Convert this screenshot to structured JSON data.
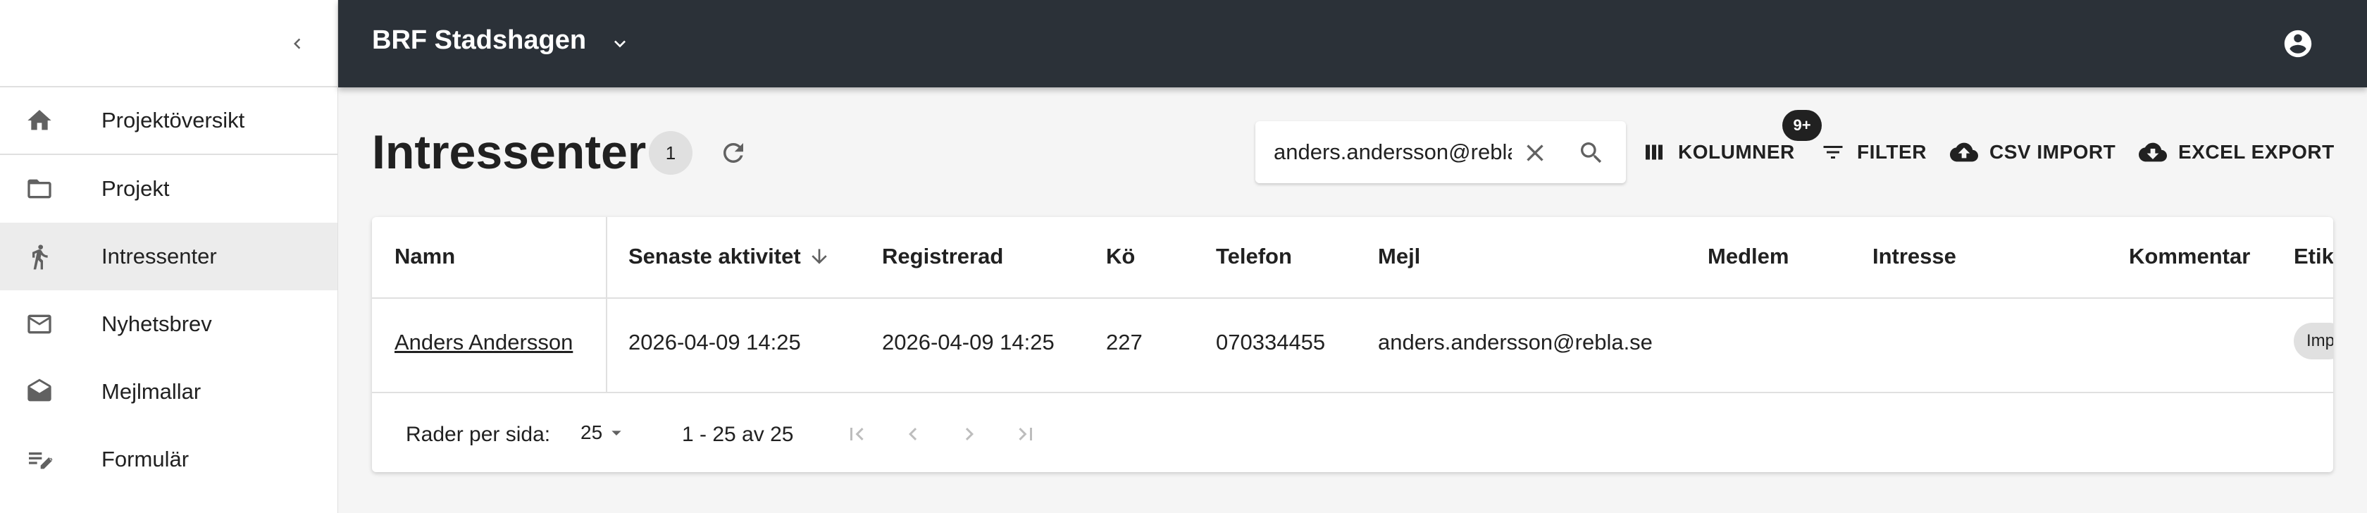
{
  "sidebar": {
    "items": [
      {
        "label": "Projektöversikt",
        "icon": "home-icon"
      },
      {
        "label": "Projekt",
        "icon": "folder-icon"
      },
      {
        "label": "Intressenter",
        "icon": "person-walking-icon",
        "active": true
      },
      {
        "label": "Nyhetsbrev",
        "icon": "mail-icon"
      },
      {
        "label": "Mejlmallar",
        "icon": "drafts-icon"
      },
      {
        "label": "Formulär",
        "icon": "form-edit-icon"
      }
    ]
  },
  "topbar": {
    "org_name": "BRF Stadshagen"
  },
  "page": {
    "title": "Intressenter",
    "count": "1"
  },
  "search": {
    "value": "anders.andersson@rebla.se"
  },
  "toolbar": {
    "columns_label": "KOLUMNER",
    "filter_label": "FILTER",
    "csv_import_label": "CSV IMPORT",
    "excel_export_label": "EXCEL EXPORT",
    "badge": "9+"
  },
  "table": {
    "headers": [
      "Namn",
      "Senaste aktivitet",
      "Registrerad",
      "Kö",
      "Telefon",
      "Mejl",
      "Medlem",
      "Intresse",
      "Kommentar",
      "Etik"
    ],
    "rows": [
      {
        "name": "Anders Andersson",
        "last_activity": "2026-04-09 14:25",
        "registered": "2026-04-09 14:25",
        "queue": "227",
        "phone": "070334455",
        "email": "anders.andersson@rebla.se",
        "member": "",
        "interest": "",
        "comment": "",
        "tag": "Imp"
      }
    ]
  },
  "pagination": {
    "rows_per_page_label": "Rader per sida:",
    "rows_per_page_value": "25",
    "range_text": "1 - 25 av 25"
  },
  "colors": {
    "topbar": "#2b3138",
    "active_nav": "#ececec",
    "icon": "#616161"
  }
}
